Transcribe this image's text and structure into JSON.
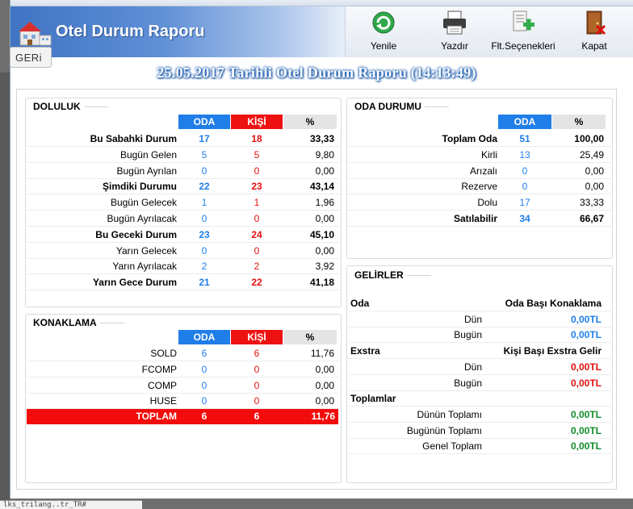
{
  "window": {
    "title": "Otel Durum Raporu",
    "toolbar": [
      {
        "label": "Yenile",
        "icon": "refresh-icon"
      },
      {
        "label": "Yazdır",
        "icon": "printer-icon"
      },
      {
        "label": "Flt.Seçenekleri",
        "icon": "filter-options-icon"
      },
      {
        "label": "Kapat",
        "icon": "close-door-icon"
      }
    ],
    "back_label": "GERi"
  },
  "report_title": "25.05.2017 Tarihli Otel Durum Raporu (14:13:49)",
  "doluluk": {
    "title": "DOLULUK",
    "headers": {
      "oda": "ODA",
      "kisi": "KİŞİ",
      "pct": "%"
    },
    "rows": [
      {
        "label": "Bu Sabahki Durum",
        "oda": "17",
        "kisi": "18",
        "pct": "33,33",
        "bold": true
      },
      {
        "label": "Bugün Gelen",
        "oda": "5",
        "kisi": "5",
        "pct": "9,80",
        "bold": false
      },
      {
        "label": "Bugün Ayrılan",
        "oda": "0",
        "kisi": "0",
        "pct": "0,00",
        "bold": false
      },
      {
        "label": "Şimdiki Durumu",
        "oda": "22",
        "kisi": "23",
        "pct": "43,14",
        "bold": true
      },
      {
        "label": "Bugün Gelecek",
        "oda": "1",
        "kisi": "1",
        "pct": "1,96",
        "bold": false
      },
      {
        "label": "Bugün Ayrılacak",
        "oda": "0",
        "kisi": "0",
        "pct": "0,00",
        "bold": false
      },
      {
        "label": "Bu Geceki Durum",
        "oda": "23",
        "kisi": "24",
        "pct": "45,10",
        "bold": true
      },
      {
        "label": "Yarın Gelecek",
        "oda": "0",
        "kisi": "0",
        "pct": "0,00",
        "bold": false
      },
      {
        "label": "Yarın Ayrılacak",
        "oda": "2",
        "kisi": "2",
        "pct": "3,92",
        "bold": false
      },
      {
        "label": "Yarın Gece Durum",
        "oda": "21",
        "kisi": "22",
        "pct": "41,18",
        "bold": true
      }
    ]
  },
  "konaklama": {
    "title": "KONAKLAMA",
    "headers": {
      "oda": "ODA",
      "kisi": "KİŞİ",
      "pct": "%"
    },
    "rows": [
      {
        "label": "SOLD",
        "oda": "6",
        "kisi": "6",
        "pct": "11,76"
      },
      {
        "label": "FCOMP",
        "oda": "0",
        "kisi": "0",
        "pct": "0,00"
      },
      {
        "label": "COMP",
        "oda": "0",
        "kisi": "0",
        "pct": "0,00"
      },
      {
        "label": "HUSE",
        "oda": "0",
        "kisi": "0",
        "pct": "0,00"
      }
    ],
    "total": {
      "label": "TOPLAM",
      "oda": "6",
      "kisi": "6",
      "pct": "11,76"
    }
  },
  "oda_durumu": {
    "title": "ODA DURUMU",
    "headers": {
      "oda": "ODA",
      "pct": "%"
    },
    "rows": [
      {
        "label": "Toplam Oda",
        "oda": "51",
        "pct": "100,00",
        "bold": true
      },
      {
        "label": "Kirli",
        "oda": "13",
        "pct": "25,49",
        "bold": false
      },
      {
        "label": "Arızalı",
        "oda": "0",
        "pct": "0,00",
        "bold": false
      },
      {
        "label": "Rezerve",
        "oda": "0",
        "pct": "0,00",
        "bold": false
      },
      {
        "label": "Dolu",
        "oda": "17",
        "pct": "33,33",
        "bold": false
      },
      {
        "label": "Satılabilir",
        "oda": "34",
        "pct": "66,67",
        "bold": true
      }
    ]
  },
  "gelirler": {
    "title": "GELİRLER",
    "oda_header": "Oda",
    "oda_sub": "Oda Başı Konaklama",
    "oda_rows": [
      {
        "label": "Dün",
        "value": "0,00TL"
      },
      {
        "label": "Bugün",
        "value": "0,00TL"
      }
    ],
    "extra_header": "Exstra",
    "extra_sub": "Kişi Başı Exstra Gelir",
    "extra_rows": [
      {
        "label": "Dün",
        "value": "0,00TL"
      },
      {
        "label": "Bugün",
        "value": "0,00TL"
      }
    ],
    "totals_header": "Toplamlar",
    "total_rows": [
      {
        "label": "Dünün Toplamı",
        "value": "0,00TL"
      },
      {
        "label": "Bugünün Toplamı",
        "value": "0,00TL"
      },
      {
        "label": "Genel Toplam",
        "value": "0,00TL"
      }
    ]
  },
  "status_strip": "lks_trilang..tr_TR#",
  "colors": {
    "oda_blue": "#1f7ee8",
    "kisi_red": "#ee1111",
    "income_blue": "#1f7ee8",
    "income_red": "#e01010",
    "income_green": "#118a2a",
    "total_row_bg": "#f20c0c"
  }
}
